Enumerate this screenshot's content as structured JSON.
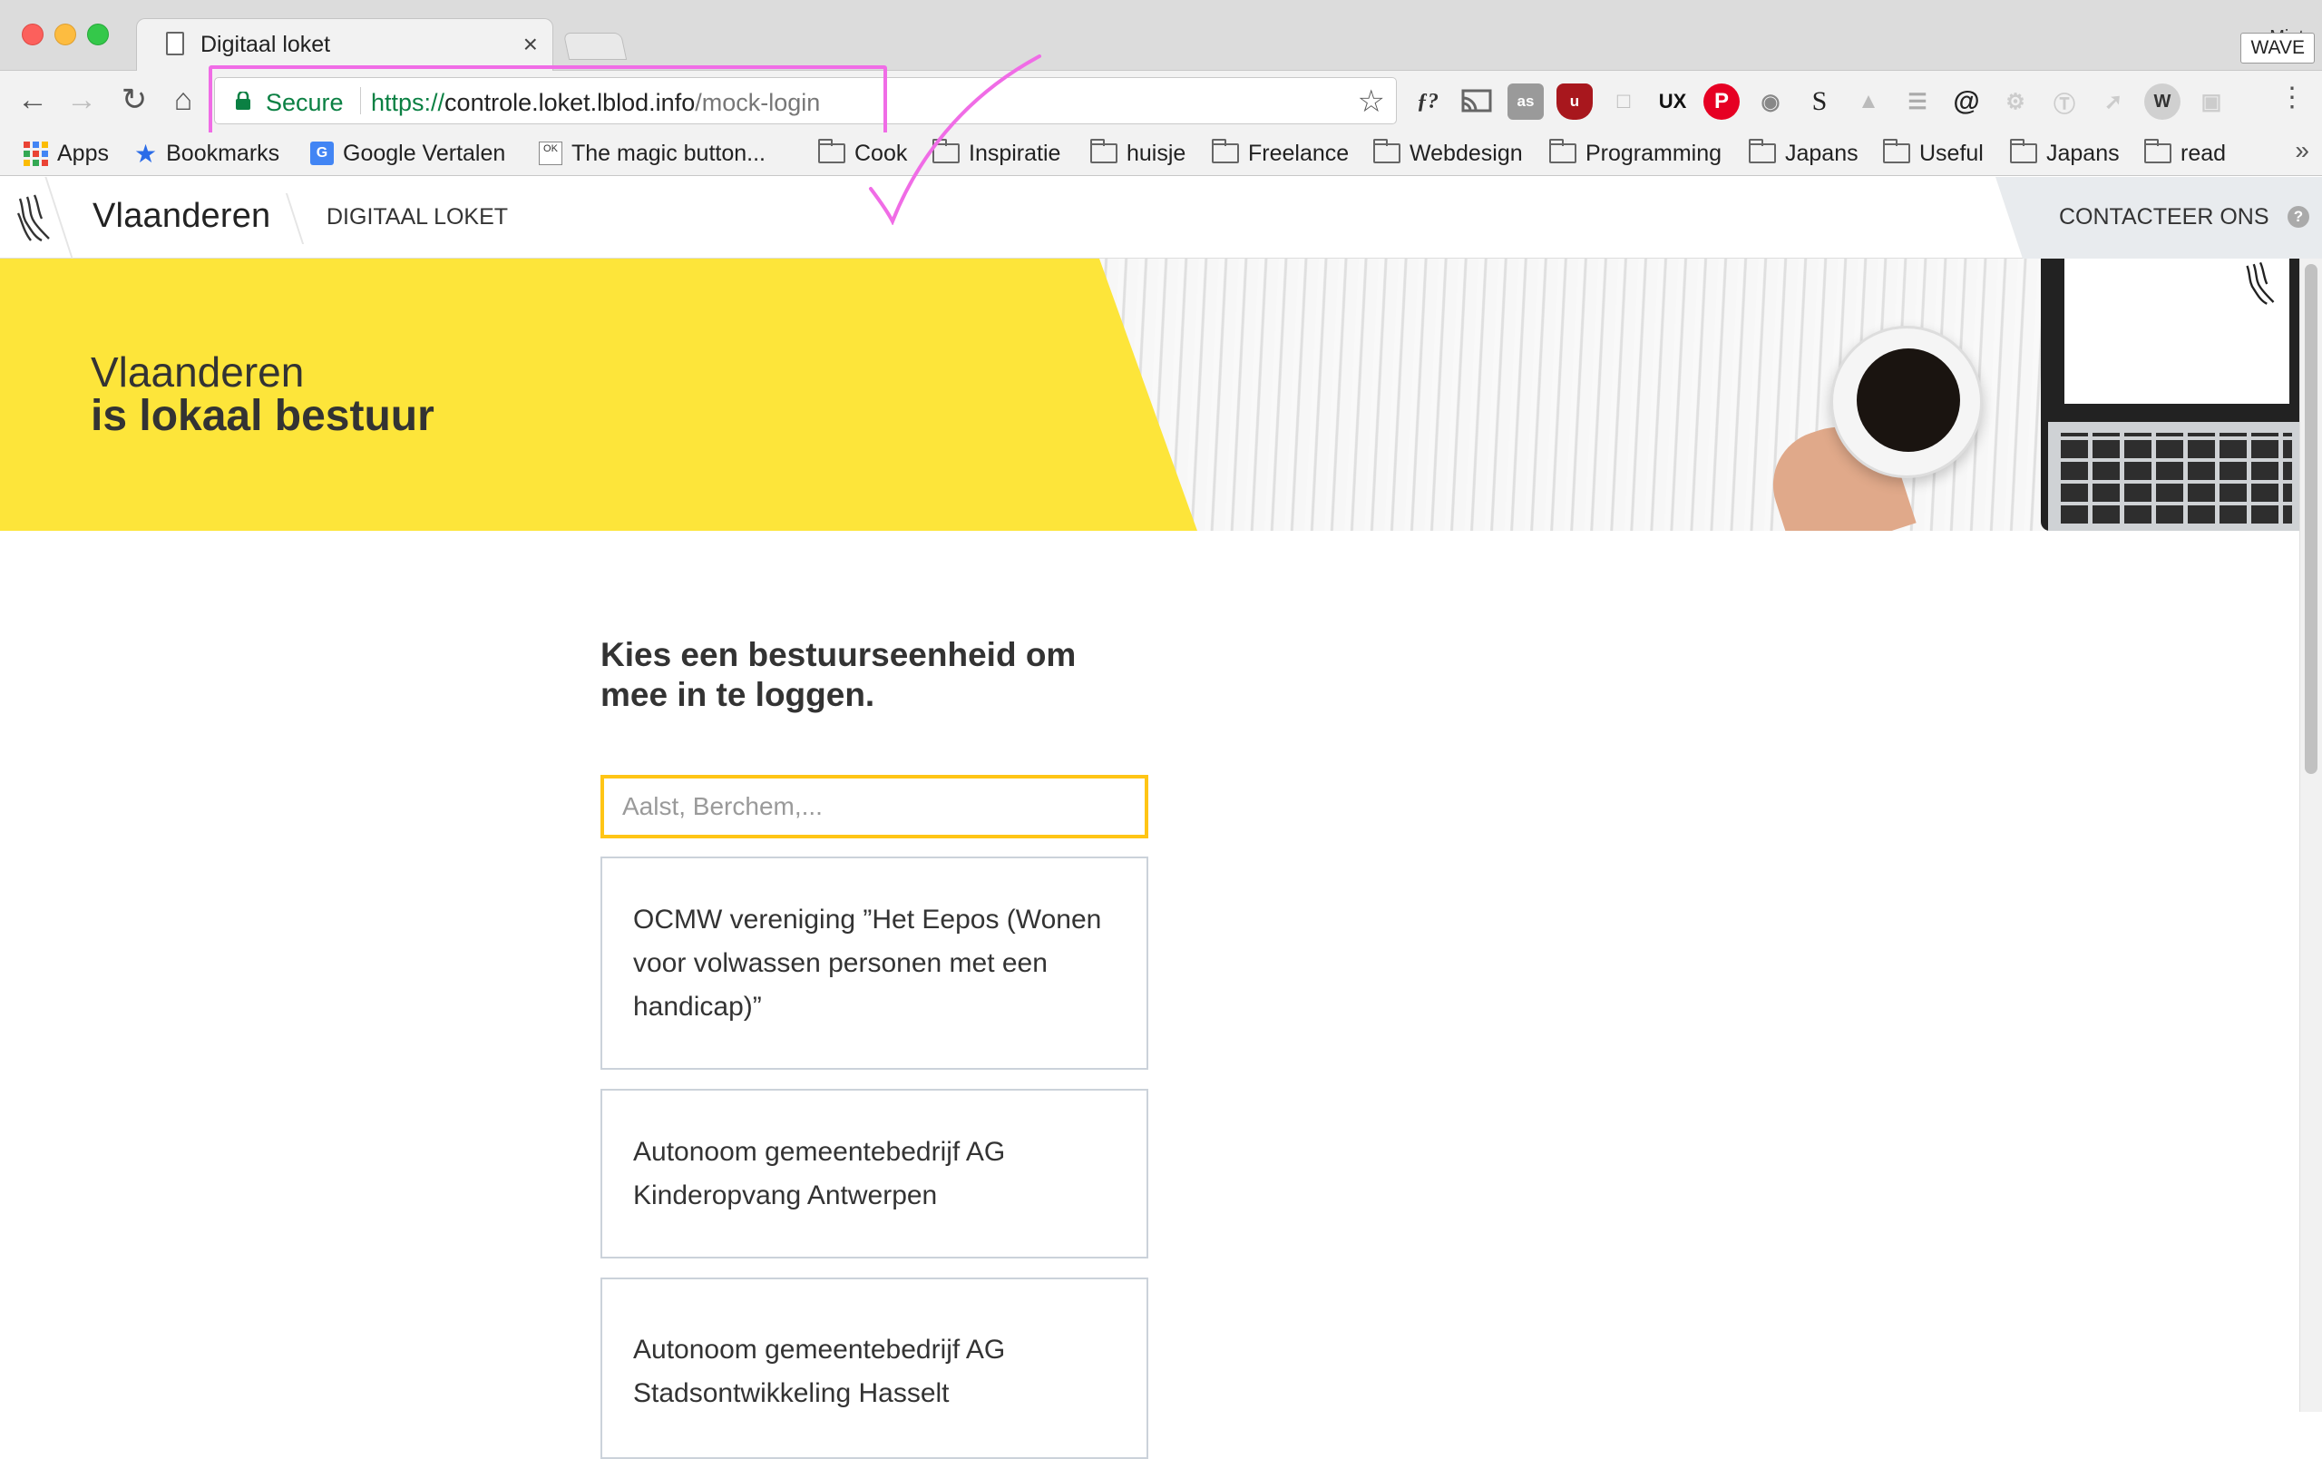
{
  "browser": {
    "tab_title": "Digitaal loket",
    "tab_close": "×",
    "user_mini": "Miet",
    "address": {
      "secure_label": "Secure",
      "url_scheme": "https://",
      "url_host": "controle.loket.lblod.info",
      "url_path": "/mock-login"
    },
    "tooltip": "WAVE",
    "extensions": [
      "ƒ?",
      "cast",
      "as",
      "ublock",
      "chat",
      "UX",
      "pinterest",
      "camera",
      "S",
      "tree",
      "lines",
      "@",
      "gear",
      "u",
      "arrow",
      "W",
      "box"
    ],
    "bookmarks": [
      {
        "label": "Apps",
        "icon": "apps-grid-icon"
      },
      {
        "label": "Bookmarks",
        "icon": "star-icon"
      },
      {
        "label": "Google Vertalen",
        "icon": "translate-icon"
      },
      {
        "label": "The magic button...",
        "icon": "ok-icon"
      },
      {
        "label": "Cook",
        "icon": "folder-icon"
      },
      {
        "label": "Inspiratie",
        "icon": "folder-icon"
      },
      {
        "label": "huisje",
        "icon": "folder-icon"
      },
      {
        "label": "Freelance",
        "icon": "folder-icon"
      },
      {
        "label": "Webdesign",
        "icon": "folder-icon"
      },
      {
        "label": "Programming",
        "icon": "folder-icon"
      },
      {
        "label": "Japans",
        "icon": "folder-icon"
      },
      {
        "label": "Useful",
        "icon": "folder-icon"
      },
      {
        "label": "Japans",
        "icon": "folder-icon"
      },
      {
        "label": "read",
        "icon": "folder-icon"
      }
    ],
    "bookmarks_more": "»"
  },
  "header": {
    "brand": "Vlaanderen",
    "app_name": "DIGITAAL LOKET",
    "contact_label": "CONTACTEER ONS",
    "contact_help": "?"
  },
  "hero": {
    "line1": "Vlaanderen",
    "line2": "is lokaal bestuur"
  },
  "main": {
    "heading": "Kies een bestuurseenheid om mee in te loggen.",
    "search_placeholder": "Aalst, Berchem,...",
    "results": [
      "OCMW vereniging ”Het Eepos (Wonen voor volwassen personen met een handicap)”",
      "Autonoom gemeentebedrijf AG Kinderopvang Antwerpen",
      "Autonoom gemeentebedrijf AG Stadsontwikkeling Hasselt"
    ]
  },
  "colors": {
    "accent_yellow": "#fde53a",
    "focus_border": "#ffc515",
    "annotation_pink": "#f06ce6",
    "secure_green": "#0b8043"
  }
}
